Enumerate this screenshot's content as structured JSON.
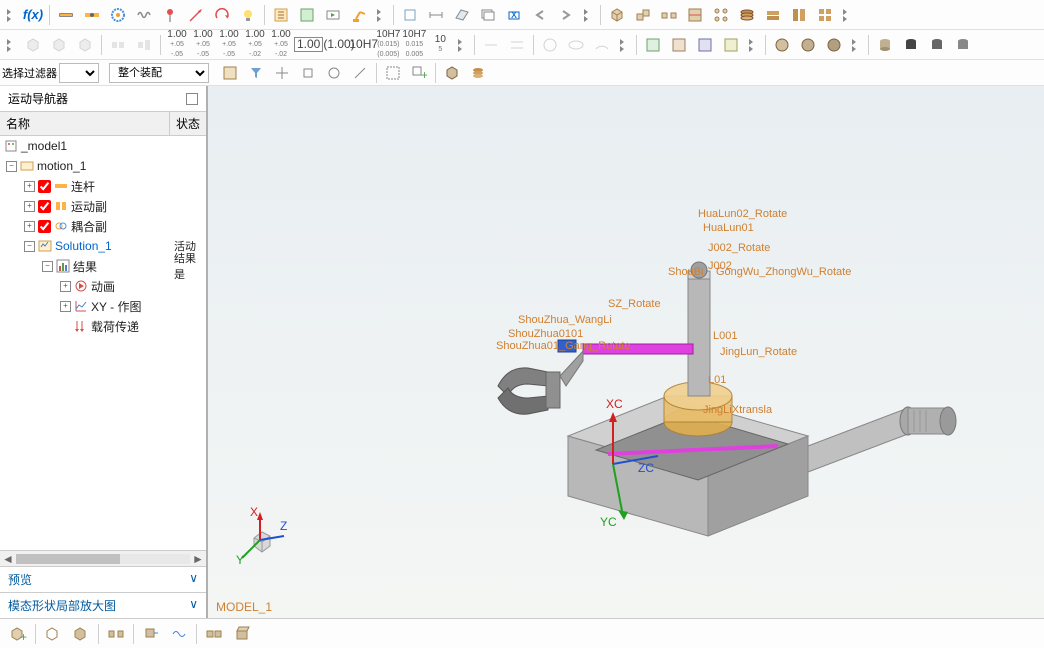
{
  "filter": {
    "left_label": "选择过滤器",
    "assembly": "整个装配"
  },
  "nav": {
    "title": "运动导航器",
    "col_name": "名称",
    "col_state": "状态",
    "preview": "预览",
    "modal": "模态形状局部放大图"
  },
  "tree": {
    "model": "_model1",
    "motion": "motion_1",
    "link": "连杆",
    "joint": "运动副",
    "couple": "耦合副",
    "solution": "Solution_1",
    "solution_state": "活动",
    "result": "结果",
    "result_state": "结果是",
    "anim": "动画",
    "xy": "XY - 作图",
    "load": "载荷传递"
  },
  "tol": {
    "v1": "1.00",
    "v1b": "+.05 -.05",
    "v2": "1.00",
    "v2b": "+.05 -.05",
    "v3": "1.00",
    "v3b": "+.05 -.05",
    "v4": "1.00",
    "v4b": "+.05 -.02",
    "v5": "1.00",
    "v5b": "+.05 -.02",
    "v6": "1.00",
    "v7": "(1.00)",
    "v8": "10H7",
    "v9": "10H7",
    "v9b": "(0.015) (0.005)",
    "v10": "10H7",
    "v10b": "0.015 0.005",
    "v11": "10",
    "v11b": "5"
  },
  "labels": {
    "xc": "XC",
    "yc": "YC",
    "zc": "ZC",
    "ax": "X",
    "ay": "Y",
    "az": "Z"
  },
  "annots": {
    "a1": "HuaLun02_Rotate",
    "a2": "HuaLun01",
    "a3": "J002_Rotate",
    "a4": "J002",
    "a5": "GongWu_ZhongWu_Rotate",
    "a6": "ShouBi",
    "a7": "SZ_Rotate",
    "a8": "ShouZhua_WangLi",
    "a9": "ShouZhua0101",
    "a10": "ShouZhua01_Gang_Rotate",
    "a11": "L001",
    "a12": "JingLun_Rotate",
    "a13": "L01",
    "a14": "JingLiXtransla"
  },
  "model_name": "MODEL_1"
}
